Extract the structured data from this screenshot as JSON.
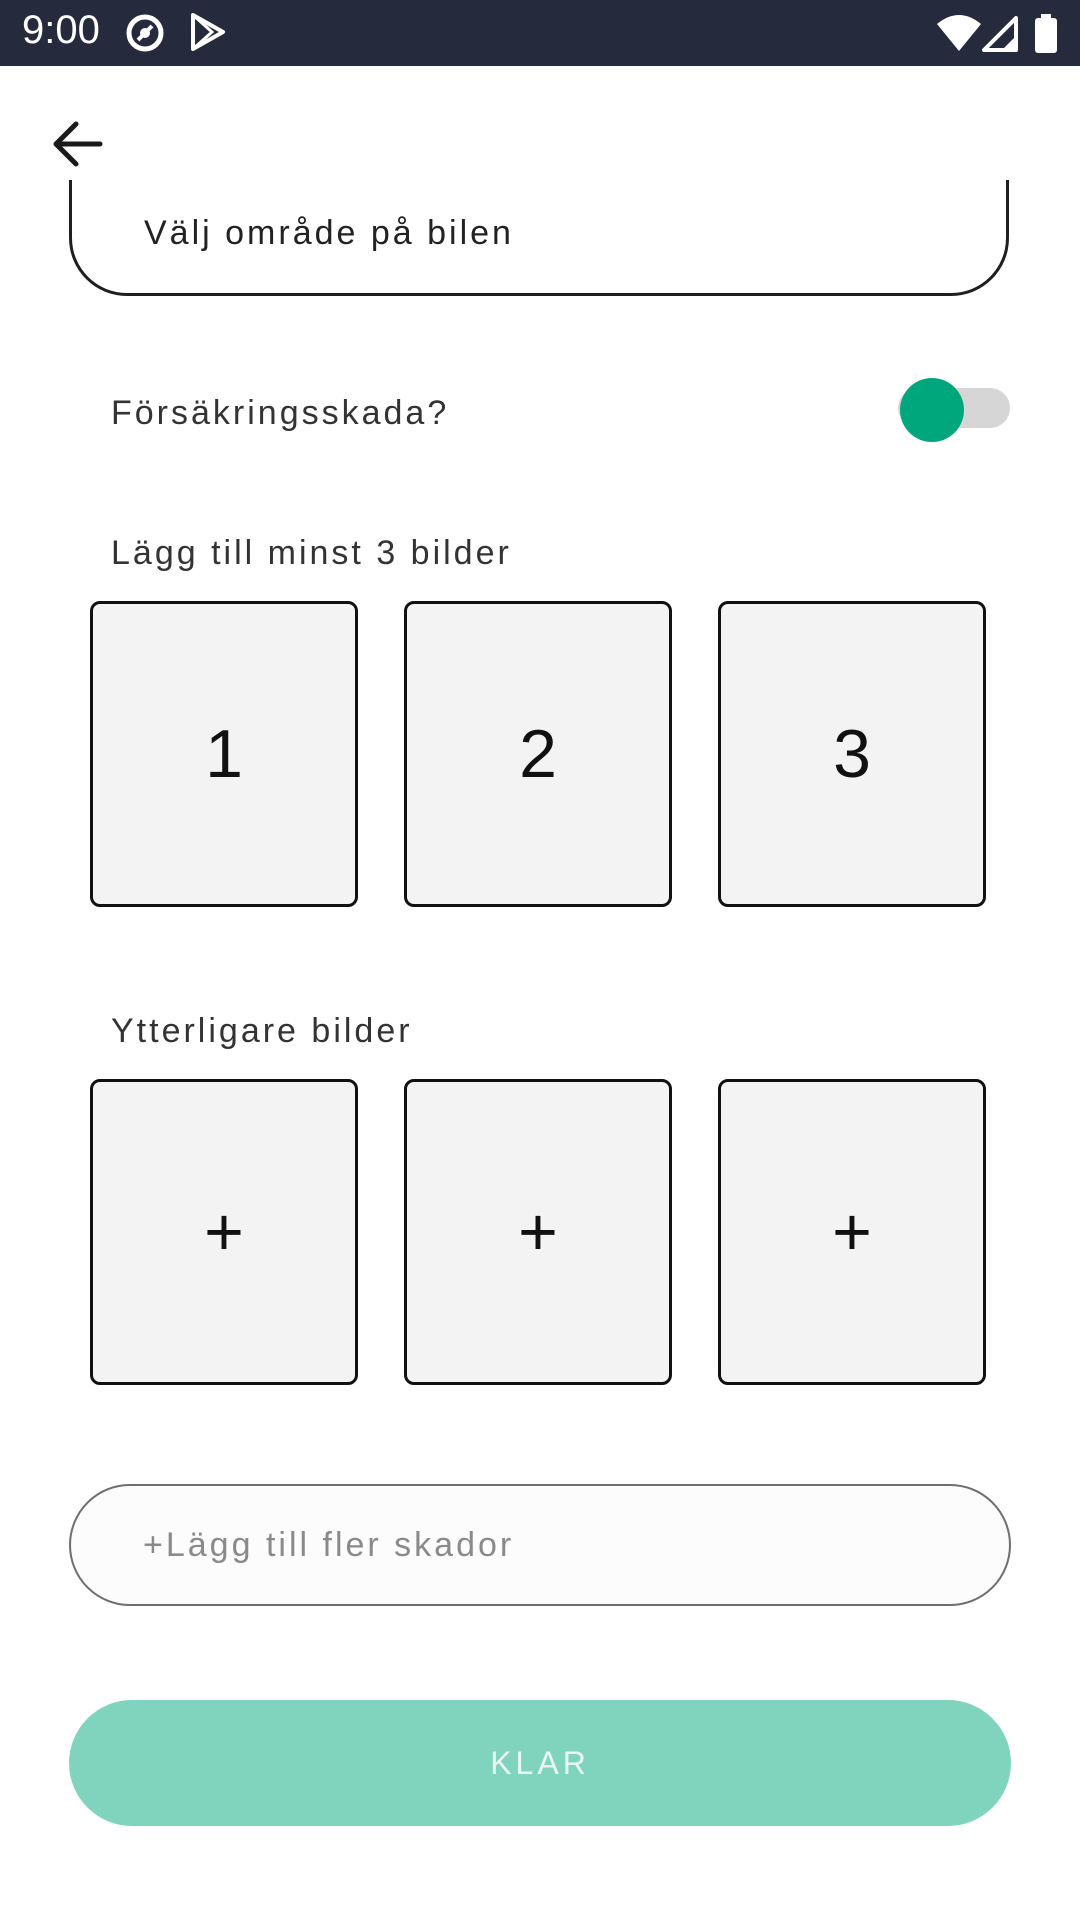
{
  "status_bar": {
    "time": "9:00",
    "icons": [
      "sync-icon",
      "play-store-icon",
      "wifi-icon",
      "cell-signal-icon",
      "battery-icon"
    ]
  },
  "header": {
    "back_icon": "arrow-left-icon"
  },
  "form": {
    "area_select_label": "Välj område på bilen",
    "insurance_label": "Försäkringsskada?",
    "insurance_toggle_on": true,
    "required_photos_heading": "Lägg till minst 3 bilder",
    "required_photos": [
      "1",
      "2",
      "3"
    ],
    "additional_photos_heading": "Ytterligare bilder",
    "additional_photos": [
      "+",
      "+",
      "+"
    ],
    "add_more_damages_label": "+Lägg till fler skador",
    "submit_label": "KLAR"
  },
  "colors": {
    "status_bar_bg": "#252b3d",
    "toggle_thumb": "#00a67c",
    "submit_bg_disabled": "#80d4bd"
  }
}
